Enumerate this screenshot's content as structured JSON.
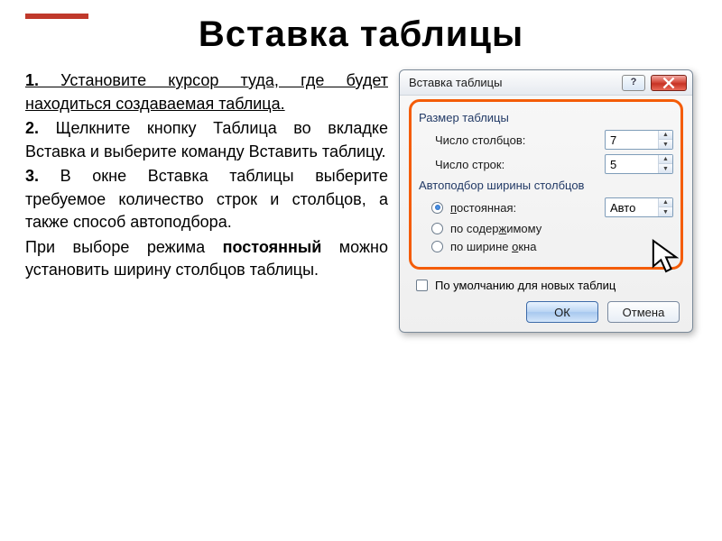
{
  "title": "Вставка таблицы",
  "instructions": {
    "p1_num": "1.",
    "p1_text": " Установите курсор туда, где будет находиться создаваемая таблица.",
    "p2_num": "2.",
    "p2_a": " Щелкните кнопку ",
    "p2_b": "Таблица",
    "p2_c": " во вкладке ",
    "p2_d": "Вставка",
    "p2_e": " и выберите команду Вставить таблицу.",
    "p3_num": "3.",
    "p3_a": " В окне ",
    "p3_b": "Вставка таблицы",
    "p3_c": " выберите требуемое количество строк и столбцов, а также способ автоподбора.",
    "p4_a": "При выборе режима ",
    "p4_b": "постоянный",
    "p4_c": " можно установить ширину столбцов таблицы."
  },
  "dialog": {
    "title": "Вставка таблицы",
    "help_glyph": "?",
    "group_size": "Размер таблицы",
    "cols_label": "Число столбцов:",
    "cols_value": "7",
    "rows_label": "Число строк:",
    "rows_value": "5",
    "group_autofit": "Автоподбор ширины столбцов",
    "r_fixed_a": "п",
    "r_fixed_b": "остоянная:",
    "fixed_value": "Авто",
    "r_content_a": "по содер",
    "r_content_b": "ж",
    "r_content_c": "имому",
    "r_window_a": "по ширине ",
    "r_window_b": "о",
    "r_window_c": "кна",
    "default_checkbox": "По умолчанию для новых таблиц",
    "ok": "ОК",
    "cancel": "Отмена"
  }
}
